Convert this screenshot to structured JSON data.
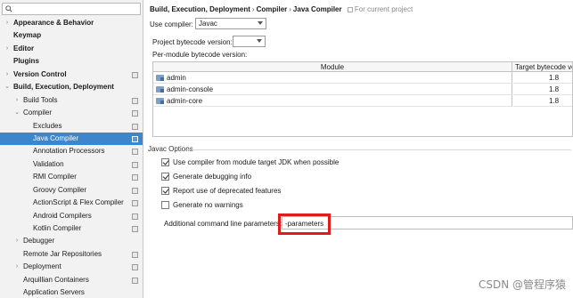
{
  "search": {
    "placeholder": ""
  },
  "sidebar": {
    "items": [
      {
        "label": "Appearance & Behavior",
        "bold": true,
        "arrow": "›",
        "indent": 0,
        "cfg": false,
        "selected": false
      },
      {
        "label": "Keymap",
        "bold": true,
        "arrow": "",
        "indent": 0,
        "cfg": false,
        "selected": false
      },
      {
        "label": "Editor",
        "bold": true,
        "arrow": "›",
        "indent": 0,
        "cfg": false,
        "selected": false
      },
      {
        "label": "Plugins",
        "bold": true,
        "arrow": "",
        "indent": 0,
        "cfg": false,
        "selected": false
      },
      {
        "label": "Version Control",
        "bold": true,
        "arrow": "›",
        "indent": 0,
        "cfg": true,
        "selected": false
      },
      {
        "label": "Build, Execution, Deployment",
        "bold": true,
        "arrow": "⌄",
        "indent": 0,
        "cfg": false,
        "selected": false
      },
      {
        "label": "Build Tools",
        "bold": false,
        "arrow": "›",
        "indent": 1,
        "cfg": true,
        "selected": false
      },
      {
        "label": "Compiler",
        "bold": false,
        "arrow": "⌄",
        "indent": 1,
        "cfg": true,
        "selected": false
      },
      {
        "label": "Excludes",
        "bold": false,
        "arrow": "",
        "indent": 2,
        "cfg": true,
        "selected": false
      },
      {
        "label": "Java Compiler",
        "bold": false,
        "arrow": "",
        "indent": 2,
        "cfg": true,
        "selected": true
      },
      {
        "label": "Annotation Processors",
        "bold": false,
        "arrow": "",
        "indent": 2,
        "cfg": true,
        "selected": false
      },
      {
        "label": "Validation",
        "bold": false,
        "arrow": "",
        "indent": 2,
        "cfg": true,
        "selected": false
      },
      {
        "label": "RMI Compiler",
        "bold": false,
        "arrow": "",
        "indent": 2,
        "cfg": true,
        "selected": false
      },
      {
        "label": "Groovy Compiler",
        "bold": false,
        "arrow": "",
        "indent": 2,
        "cfg": true,
        "selected": false
      },
      {
        "label": "ActionScript & Flex Compiler",
        "bold": false,
        "arrow": "",
        "indent": 2,
        "cfg": true,
        "selected": false
      },
      {
        "label": "Android Compilers",
        "bold": false,
        "arrow": "",
        "indent": 2,
        "cfg": true,
        "selected": false
      },
      {
        "label": "Kotlin Compiler",
        "bold": false,
        "arrow": "",
        "indent": 2,
        "cfg": true,
        "selected": false
      },
      {
        "label": "Debugger",
        "bold": false,
        "arrow": "›",
        "indent": 1,
        "cfg": false,
        "selected": false
      },
      {
        "label": "Remote Jar Repositories",
        "bold": false,
        "arrow": "",
        "indent": 1,
        "cfg": true,
        "selected": false
      },
      {
        "label": "Deployment",
        "bold": false,
        "arrow": "›",
        "indent": 1,
        "cfg": true,
        "selected": false
      },
      {
        "label": "Arquillian Containers",
        "bold": false,
        "arrow": "",
        "indent": 1,
        "cfg": true,
        "selected": false
      },
      {
        "label": "Application Servers",
        "bold": false,
        "arrow": "",
        "indent": 1,
        "cfg": false,
        "selected": false
      }
    ]
  },
  "breadcrumb": {
    "parts": [
      "Build, Execution, Deployment",
      "Compiler",
      "Java Compiler"
    ],
    "separator": "›",
    "project_note": "For current project"
  },
  "compiler": {
    "label": "Use compiler:",
    "value": "Javac"
  },
  "bytecode": {
    "label": "Project bytecode version:",
    "value": ""
  },
  "per_module_label": "Per-module bytecode version:",
  "modules_table": {
    "headers": [
      "Module",
      "Target bytecode ve"
    ],
    "rows": [
      {
        "module": "admin",
        "target": "1.8"
      },
      {
        "module": "admin-console",
        "target": "1.8"
      },
      {
        "module": "admin-core",
        "target": "1.8"
      }
    ]
  },
  "javac_options": {
    "title": "Javac Options",
    "checkboxes": [
      {
        "label": "Use compiler from module target JDK when possible",
        "checked": true
      },
      {
        "label": "Generate debugging info",
        "checked": true
      },
      {
        "label": "Report use of deprecated features",
        "checked": true
      },
      {
        "label": "Generate no warnings",
        "checked": false
      }
    ],
    "params_label": "Additional command line parameters:",
    "params_value": "-parameters"
  },
  "watermark": "CSDN @管程序猿",
  "colors": {
    "selected": "#3b86cc",
    "highlight": "#e01b1b"
  }
}
